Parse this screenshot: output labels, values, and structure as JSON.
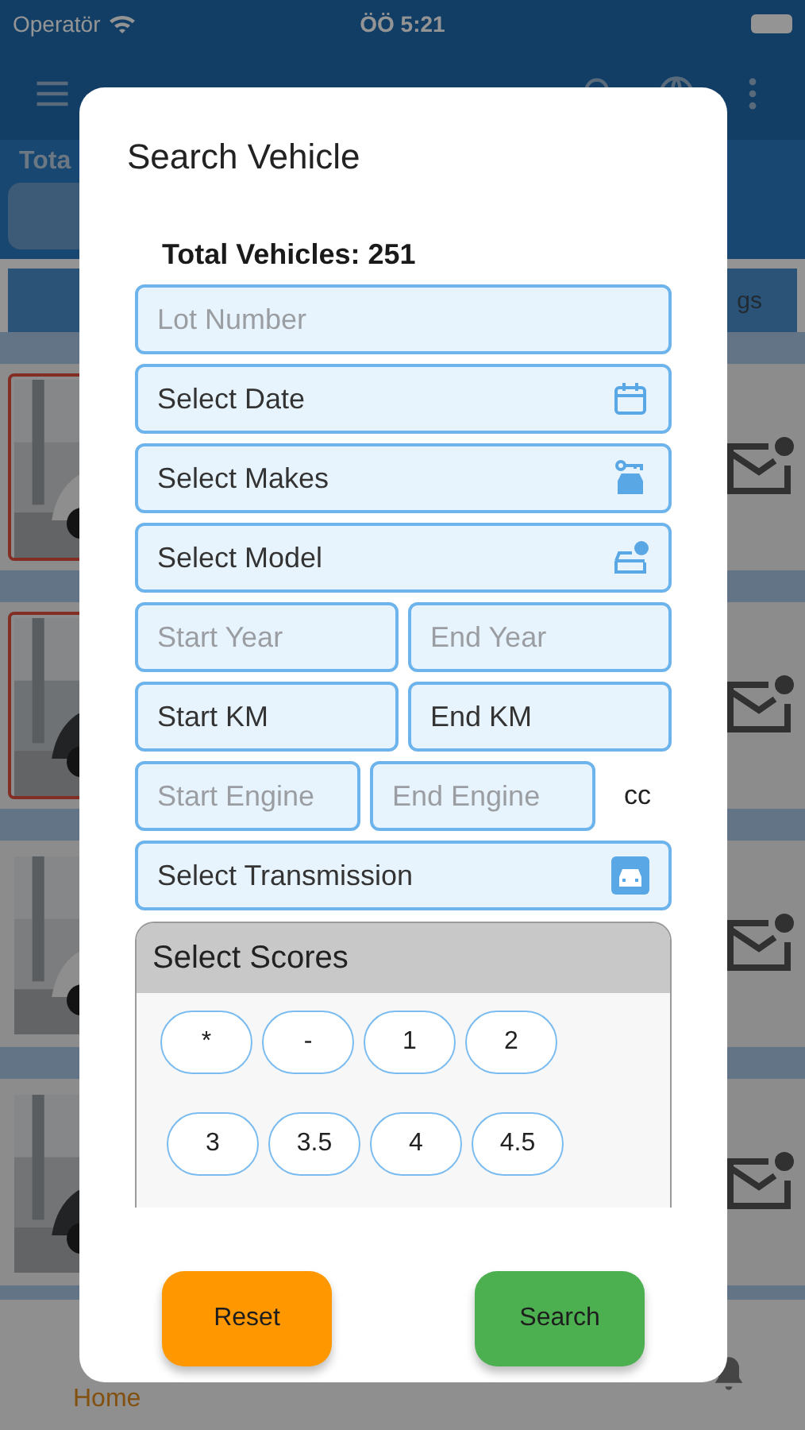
{
  "status_bar": {
    "carrier": "Operatör",
    "time": "ÖÖ 5:21"
  },
  "background": {
    "total_label": "Tota",
    "tab_label": "gs",
    "listings": [
      {
        "kind": "picture",
        "highlighted": true
      },
      {
        "kind": "picture",
        "highlighted": true
      },
      {
        "kind": "picture",
        "highlighted": false
      },
      {
        "kind": "picture",
        "highlighted": false
      }
    ],
    "nav": {
      "home_label": "Home"
    }
  },
  "dialog": {
    "title": "Search Vehicle",
    "total": "Total Vehicles: 251",
    "fields": [
      {
        "kind": "text",
        "placeholder": "Lot Number"
      },
      {
        "kind": "date",
        "value": "Select Date"
      },
      {
        "kind": "make",
        "value": "Select Makes"
      },
      {
        "kind": "model",
        "value": "Select Model"
      },
      {
        "kind": "pair",
        "items": [
          {
            "placeholder": "Start Year"
          },
          {
            "placeholder": "End Year"
          }
        ]
      },
      {
        "kind": "pair",
        "items": [
          {
            "value": "Start KM"
          },
          {
            "value": "End KM"
          }
        ]
      },
      {
        "kind": "pair",
        "items": [
          {
            "placeholder": "Start Engine"
          },
          {
            "placeholder": "End Engine"
          }
        ],
        "unit": "cc"
      },
      {
        "kind": "transmission",
        "value": "Select Transmission"
      }
    ],
    "scores": {
      "title": "Select Scores",
      "rows": [
        {
          "options": [
            {
              "label": "*",
              "selected": false
            },
            {
              "label": "-",
              "selected": false
            },
            {
              "label": "1",
              "selected": false
            },
            {
              "label": "2",
              "selected": false
            }
          ]
        },
        {
          "options": [
            {
              "label": "3",
              "selected": false
            },
            {
              "label": "3.5",
              "selected": false
            },
            {
              "label": "4",
              "selected": false
            },
            {
              "label": "4.5",
              "selected": false
            }
          ]
        }
      ]
    },
    "buttons": [
      {
        "kind": "reset",
        "label": "Reset"
      },
      {
        "kind": "search",
        "label": "Search"
      }
    ]
  }
}
